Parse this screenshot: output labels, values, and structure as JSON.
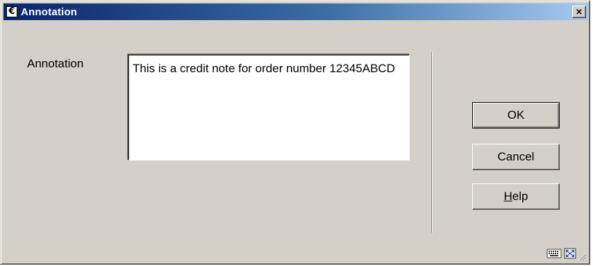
{
  "window": {
    "title": "Annotation",
    "app_icon_glyph": "€",
    "close_glyph": "×"
  },
  "form": {
    "annotation_label": "Annotation",
    "annotation_value": "This is a credit note for order number 12345ABCD"
  },
  "buttons": {
    "ok_label": "OK",
    "cancel_label": "Cancel",
    "help_mnemonic": "H",
    "help_rest": "elp"
  },
  "icons": {
    "app": "euro-app-icon",
    "close": "close-icon",
    "status_1": "keyboard-icon",
    "status_2": "resize-window-icon",
    "grip": "resize-grip-icon"
  },
  "colors": {
    "titlebar_start": "#0a246a",
    "titlebar_end": "#a6caf0",
    "dialog_bg": "#d4d0c8"
  }
}
